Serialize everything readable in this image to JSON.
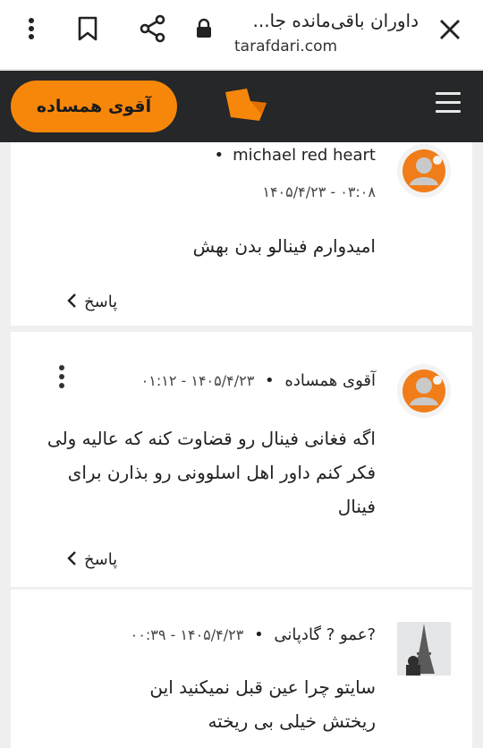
{
  "browser": {
    "tab_title": "داوران باقی‌مانده جا...",
    "url": "tarafdari.com"
  },
  "header": {
    "user_button": "آقوی همساده"
  },
  "comments": [
    {
      "author": "michael red heart",
      "separator": "•",
      "timestamp": "۱۴۰۵/۴/۲۳ - ۰۳:۰۸",
      "body": "امیدوارم فینالو بدن بهش",
      "reply": "پاسخ"
    },
    {
      "author": "آقوی همساده",
      "separator": "•",
      "timestamp": "۱۴۰۵/۴/۲۳ - ۰۱:۱۲",
      "body": "اگه فغانی فینال رو قضاوت کنه که عالیه ولی فکر کنم داور اهل اسلوونی رو بذارن برای فینال",
      "reply": "پاسخ"
    },
    {
      "author": "?عمو ? گادپانی",
      "separator": "•",
      "timestamp": "۱۴۰۵/۴/۲۳ - ۰۰:۳۹",
      "body": "سایتو چرا عین قبل نمیکنید این ریختش خیلی بی ریخته"
    }
  ],
  "colors": {
    "accent": "#f7870a",
    "header_bg": "#252728",
    "page_bg": "#efefef"
  },
  "icons": [
    "more-vert-icon",
    "bookmark-icon",
    "share-icon",
    "lock-icon",
    "close-icon",
    "hamburger-icon",
    "site-logo",
    "chevron-left-icon",
    "default-avatar-icon"
  ]
}
